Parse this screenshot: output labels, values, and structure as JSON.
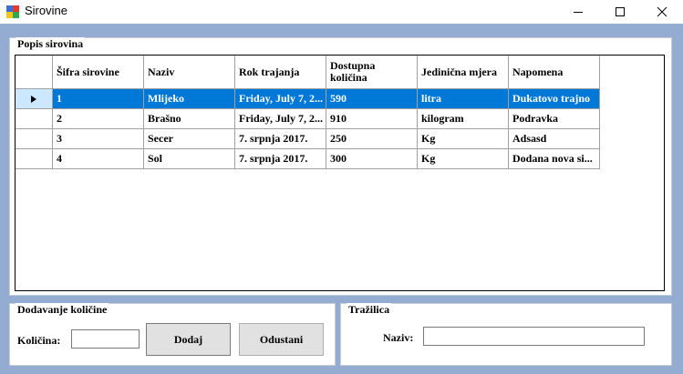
{
  "window": {
    "title": "Sirovine"
  },
  "popis": {
    "group_label": "Popis sirovina",
    "columns": [
      "Šifra sirovine",
      "Naziv",
      "Rok trajanja",
      "Dostupna količina",
      "Jedinična mjera",
      "Napomena"
    ],
    "rows": [
      [
        "1",
        "Mlijeko",
        "Friday, July 7, 2...",
        "590",
        "litra",
        "Dukatovo trajno"
      ],
      [
        "2",
        "Brašno",
        "Friday, July 7, 2...",
        "910",
        "kilogram",
        "Podravka"
      ],
      [
        "3",
        "Secer",
        "7. srpnja 2017.",
        "250",
        "Kg",
        "Adsasd"
      ],
      [
        "4",
        "Sol",
        "7. srpnja 2017.",
        "300",
        "Kg",
        "Dodana nova si..."
      ]
    ],
    "selected_row": 0
  },
  "dodavanje": {
    "group_label": "Dodavanje količine",
    "kolicina_label": "Količina:",
    "kolicina_value": "",
    "dodaj_label": "Dodaj",
    "odustani_label": "Odustani"
  },
  "trazilica": {
    "group_label": "Tražilica",
    "naziv_label": "Naziv:",
    "naziv_value": ""
  },
  "colors": {
    "selection": "#0078d7",
    "client_bg": "#94acd1",
    "row_header_selected": "#cce8ff"
  }
}
